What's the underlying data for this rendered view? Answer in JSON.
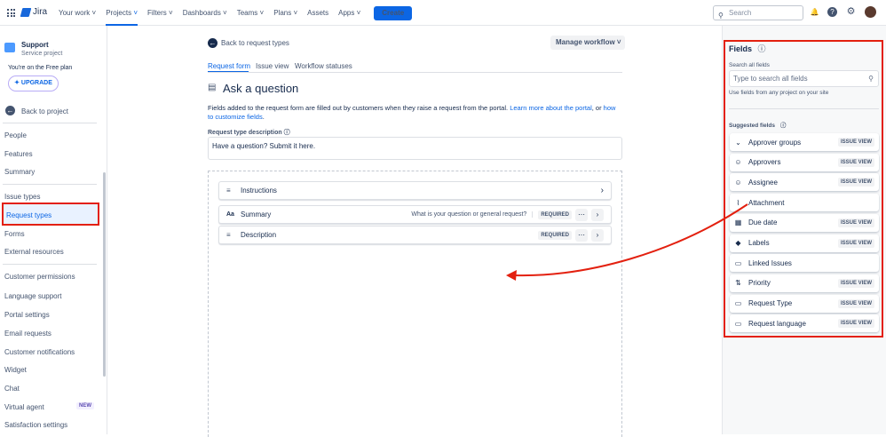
{
  "topnav": {
    "product": "Jira",
    "items": [
      "Your work",
      "Projects",
      "Filters",
      "Dashboards",
      "Teams",
      "Plans",
      "Assets",
      "Apps"
    ],
    "create": "Create",
    "search_placeholder": "Search"
  },
  "sidebar": {
    "project_name": "Support",
    "project_type": "Service project",
    "plan_text": "You're on the Free plan",
    "upgrade": "UPGRADE",
    "back": "Back to project",
    "items": [
      {
        "label": "People"
      },
      {
        "label": "Features"
      },
      {
        "label": "Summary"
      },
      {
        "label": "Issue types"
      },
      {
        "label": "Request types"
      },
      {
        "label": "Forms"
      },
      {
        "label": "External resources"
      },
      {
        "label": "Customer permissions"
      },
      {
        "label": "Language support"
      },
      {
        "label": "Portal settings"
      },
      {
        "label": "Email requests"
      },
      {
        "label": "Customer notifications"
      },
      {
        "label": "Widget"
      },
      {
        "label": "Chat"
      },
      {
        "label": "Virtual agent",
        "badge": "NEW"
      },
      {
        "label": "Satisfaction settings"
      }
    ]
  },
  "main": {
    "back": "Back to request types",
    "manage": "Manage workflow",
    "tabs": [
      "Request form",
      "Issue view",
      "Workflow statuses"
    ],
    "title": "Ask a question",
    "desc": "Fields added to the request form are filled out by customers when they raise a request from the portal. ",
    "link1": "Learn more about the portal",
    "or": ", or ",
    "link2": "how to customize fields",
    "period": ".",
    "desc_label": "Request type description",
    "desc_value": "Have a question? Submit it here.",
    "rows": [
      {
        "label": "Instructions",
        "hint": "",
        "required": ""
      },
      {
        "label": "Summary",
        "hint": "What is your question or general request?",
        "required": "REQUIRED"
      },
      {
        "label": "Description",
        "hint": "",
        "required": "REQUIRED"
      }
    ]
  },
  "fields": {
    "title": "Fields",
    "search_label": "Search all fields",
    "search_placeholder": "Type to search all fields",
    "search_help": "Use fields from any project on your site",
    "suggested": "Suggested fields",
    "items": [
      {
        "label": "Approver groups",
        "tag": "ISSUE VIEW",
        "icon": "group"
      },
      {
        "label": "Approvers",
        "tag": "ISSUE VIEW",
        "icon": "user"
      },
      {
        "label": "Assignee",
        "tag": "ISSUE VIEW",
        "icon": "user"
      },
      {
        "label": "Attachment",
        "tag": "",
        "icon": "paperclip"
      },
      {
        "label": "Due date",
        "tag": "ISSUE VIEW",
        "icon": "calendar"
      },
      {
        "label": "Labels",
        "tag": "ISSUE VIEW",
        "icon": "tag"
      },
      {
        "label": "Linked Issues",
        "tag": "",
        "icon": "link"
      },
      {
        "label": "Priority",
        "tag": "ISSUE VIEW",
        "icon": "priority"
      },
      {
        "label": "Request Type",
        "tag": "ISSUE VIEW",
        "icon": "request"
      },
      {
        "label": "Request language",
        "tag": "ISSUE VIEW",
        "icon": "request"
      }
    ]
  },
  "colors": {
    "accent": "#0c66e4",
    "annotation": "#e3200f"
  }
}
